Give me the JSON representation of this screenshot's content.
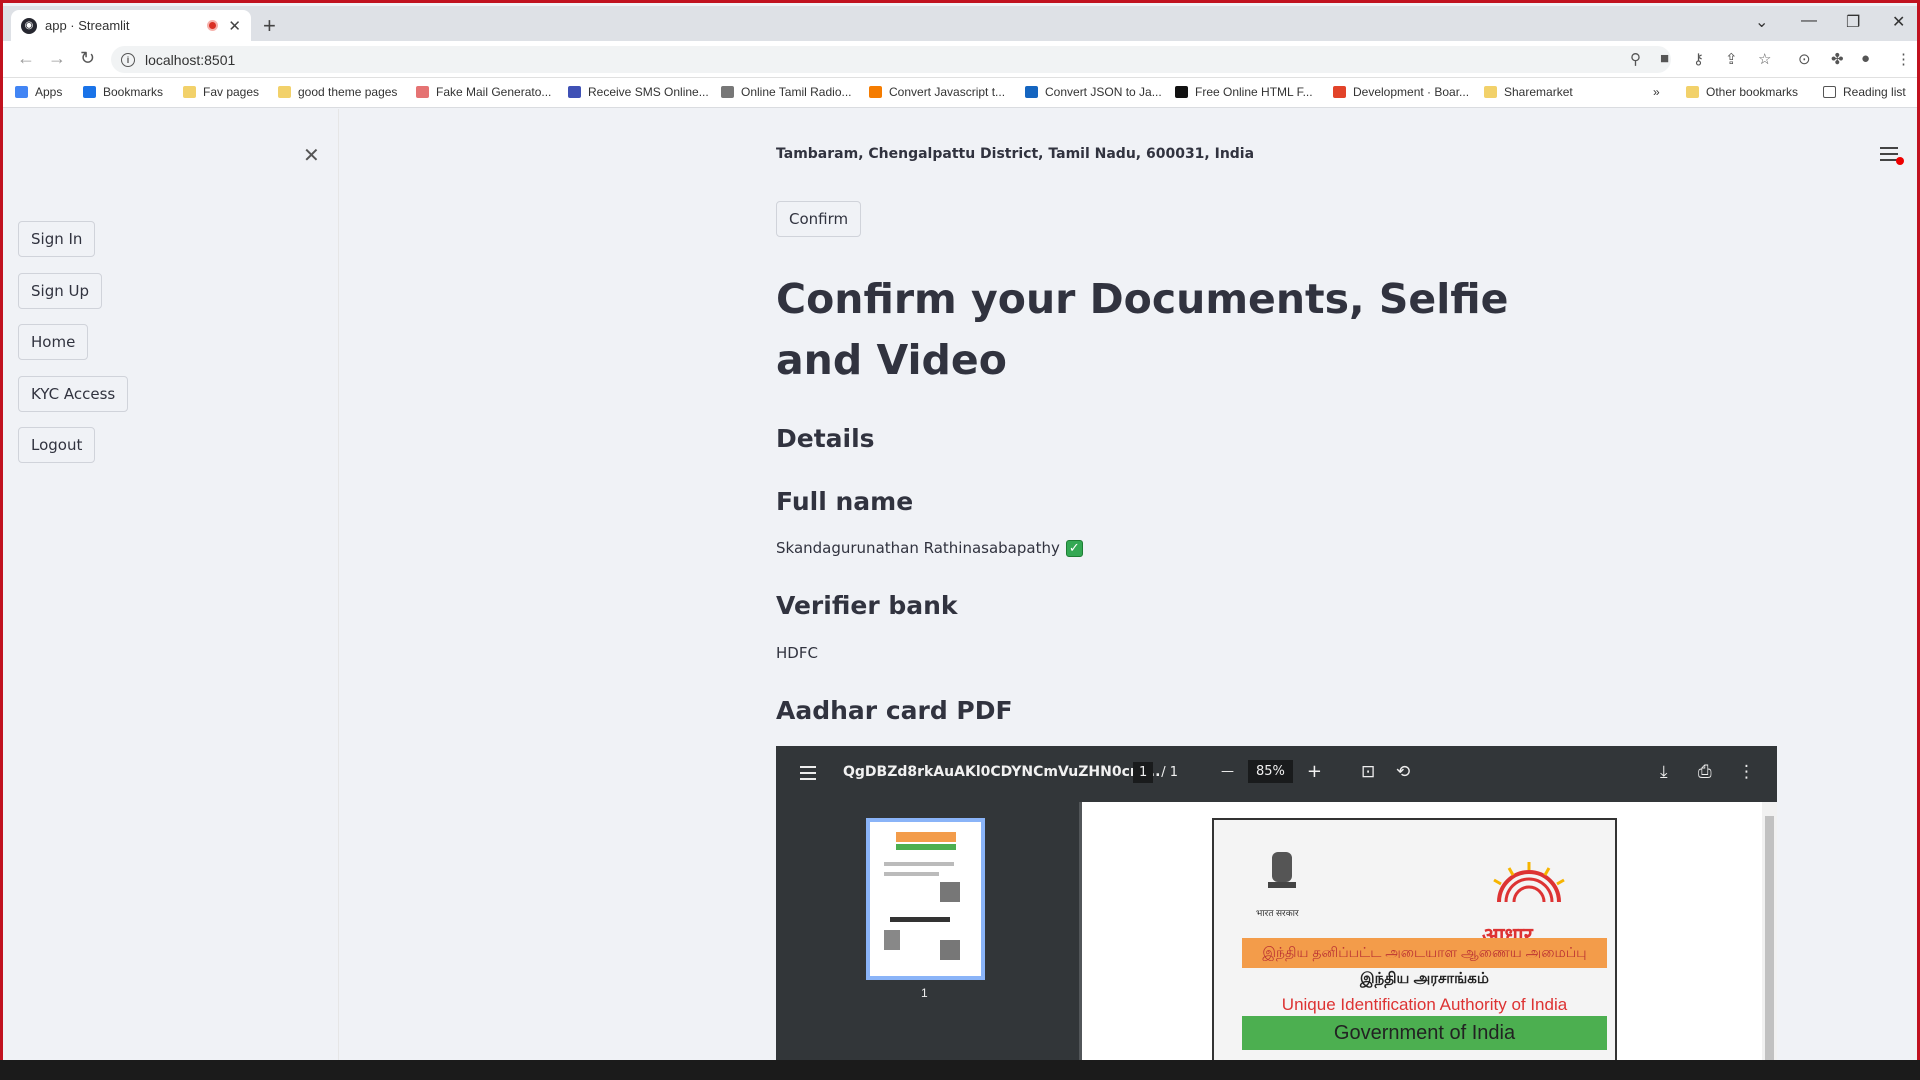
{
  "browser": {
    "tab_title": "app · Streamlit",
    "address": "localhost:8501"
  },
  "bookmarks": [
    "Apps",
    "Bookmarks",
    "Fav pages",
    "good theme pages",
    "Fake Mail Generato...",
    "Receive SMS Online...",
    "Online Tamil Radio...",
    "Convert Javascript t...",
    "Convert JSON to Ja...",
    "Free Online HTML F...",
    "Development · Boar...",
    "Sharemarket",
    "Other bookmarks",
    "Reading list"
  ],
  "sidebar": {
    "buttons": [
      "Sign In",
      "Sign Up",
      "Home",
      "KYC Access",
      "Logout"
    ]
  },
  "main": {
    "address_line": "Tambaram, Chengalpattu District, Tamil Nadu, 600031, India",
    "confirm_label": "Confirm",
    "title": "Confirm your Documents, Selfie and Video",
    "details_heading": "Details",
    "fullname_heading": "Full name",
    "fullname_value": "Skandagurunathan Rathinasabapathy",
    "verifier_heading": "Verifier bank",
    "verifier_value": "HDFC",
    "aadhar_heading": "Aadhar card PDF"
  },
  "pdf_viewer": {
    "filename": "QgDBZd8rkAuAKl0CDYNCmVuZHN0cm...",
    "page_current": "1",
    "page_total": "/ 1",
    "zoom": "85%",
    "thumb_label": "1",
    "card": {
      "logo_text": "आधार",
      "emblem_text": "भारत सरकार",
      "tamil_authority": "இந்திய தனிப்பட்ட அடையாள ஆணைய அமைப்பு",
      "tamil_govt": "இந்திய அரசாங்கம்",
      "uid_text": "Unique Identification Authority of India",
      "govt_text": "Government of India"
    }
  },
  "colors": {
    "record_indicator": "#d93025",
    "window_border": "#c1121f",
    "checkmark": "#34a853"
  }
}
